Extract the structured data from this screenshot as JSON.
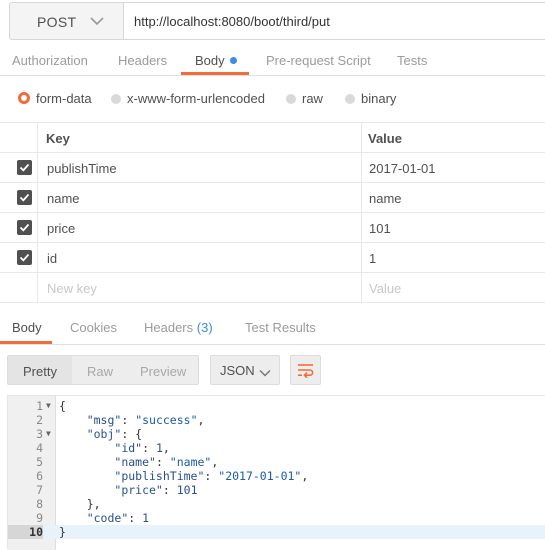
{
  "request": {
    "method": "POST",
    "url": "http://localhost:8080/boot/third/put"
  },
  "request_tabs": [
    {
      "label": "Authorization",
      "active": false
    },
    {
      "label": "Headers",
      "active": false
    },
    {
      "label": "Body",
      "active": true
    },
    {
      "label": "Pre-request Script",
      "active": false
    },
    {
      "label": "Tests",
      "active": false
    }
  ],
  "body_types": [
    {
      "label": "form-data",
      "selected": true
    },
    {
      "label": "x-www-form-urlencoded",
      "selected": false
    },
    {
      "label": "raw",
      "selected": false
    },
    {
      "label": "binary",
      "selected": false
    }
  ],
  "params_table": {
    "headers": {
      "key": "Key",
      "value": "Value"
    },
    "rows": [
      {
        "key": "publishTime",
        "value": "2017-01-01",
        "checked": true
      },
      {
        "key": "name",
        "value": "name",
        "checked": true
      },
      {
        "key": "price",
        "value": "101",
        "checked": true
      },
      {
        "key": "id",
        "value": "1",
        "checked": true
      }
    ],
    "new_row": {
      "key_placeholder": "New key",
      "value_placeholder": "Value"
    }
  },
  "response_tabs": [
    {
      "label": "Body",
      "active": true
    },
    {
      "label": "Cookies",
      "active": false
    },
    {
      "label": "Headers",
      "count": "(3)",
      "active": false
    },
    {
      "label": "Test Results",
      "active": false
    }
  ],
  "response_toolbar": {
    "formats": [
      {
        "label": "Pretty",
        "active": true
      },
      {
        "label": "Raw",
        "active": false
      },
      {
        "label": "Preview",
        "active": false
      }
    ],
    "language": "JSON",
    "wrap_icon": "wrap-lines-icon"
  },
  "response_body": {
    "lines": [
      {
        "n": "1",
        "fold": true,
        "text": "{"
      },
      {
        "n": "2",
        "fold": false,
        "text": "    \"msg\": \"success\","
      },
      {
        "n": "3",
        "fold": true,
        "text": "    \"obj\": {"
      },
      {
        "n": "4",
        "fold": false,
        "text": "        \"id\": 1,"
      },
      {
        "n": "5",
        "fold": false,
        "text": "        \"name\": \"name\","
      },
      {
        "n": "6",
        "fold": false,
        "text": "        \"publishTime\": \"2017-01-01\","
      },
      {
        "n": "7",
        "fold": false,
        "text": "        \"price\": 101"
      },
      {
        "n": "8",
        "fold": false,
        "text": "    },"
      },
      {
        "n": "9",
        "fold": false,
        "text": "    \"code\": 1"
      },
      {
        "n": "10",
        "fold": false,
        "text": "}"
      }
    ],
    "active_line": "10"
  },
  "colors": {
    "accent": "#f26b3a",
    "count_blue": "#3b8ee8",
    "checkbox": "#505050"
  }
}
